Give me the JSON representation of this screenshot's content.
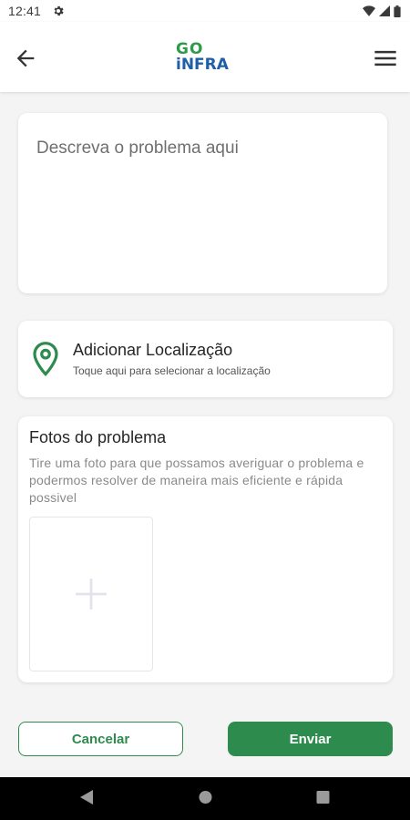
{
  "status_bar": {
    "time": "12:41"
  },
  "app_bar": {
    "logo_line1": "GO",
    "logo_line2": "iNFRA"
  },
  "description": {
    "placeholder": "Descreva o problema aqui",
    "value": ""
  },
  "location": {
    "title": "Adicionar Localização",
    "subtitle": "Toque aqui para selecionar a localização"
  },
  "photos": {
    "title": "Fotos do problema",
    "description": "Tire uma foto para que possamos averiguar o problema e podermos resolver de maneira mais eficiente e rápida possivel"
  },
  "buttons": {
    "cancel": "Cancelar",
    "send": "Enviar"
  },
  "colors": {
    "primary": "#2e8b4e",
    "logo_green": "#2e9a4b",
    "logo_blue": "#1f5fa8"
  },
  "icons": [
    "gear-icon",
    "wifi-icon",
    "signal-icon",
    "battery-icon",
    "back-arrow-icon",
    "hamburger-menu-icon",
    "location-pin-icon",
    "plus-icon",
    "nav-back-icon",
    "nav-home-icon",
    "nav-recents-icon"
  ]
}
